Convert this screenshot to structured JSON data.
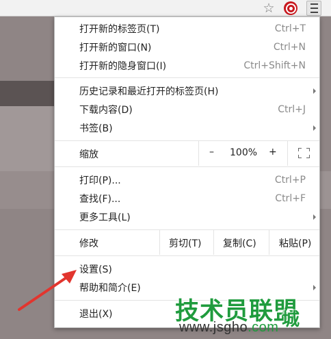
{
  "browser": {
    "star_glyph": "☆",
    "extension_icon": "red-circle-extension-icon",
    "menu_icon": "hamburger-icon"
  },
  "menu": {
    "group1": [
      {
        "label": "打开新的标签页(T)",
        "shortcut": "Ctrl+T"
      },
      {
        "label": "打开新的窗口(N)",
        "shortcut": "Ctrl+N"
      },
      {
        "label": "打开新的隐身窗口(I)",
        "shortcut": "Ctrl+Shift+N"
      }
    ],
    "group2": [
      {
        "label": "历史记录和最近打开的标签页(H)",
        "shortcut": ""
      },
      {
        "label": "下载内容(D)",
        "shortcut": "Ctrl+J"
      },
      {
        "label": "书签(B)",
        "shortcut": ""
      }
    ],
    "zoom": {
      "label": "缩放",
      "minus": "–",
      "value": "100%",
      "plus": "+"
    },
    "group3": [
      {
        "label": "打印(P)...",
        "shortcut": "Ctrl+P"
      },
      {
        "label": "查找(F)...",
        "shortcut": "Ctrl+F"
      },
      {
        "label": "更多工具(L)",
        "shortcut": ""
      }
    ],
    "edit": {
      "label": "修改",
      "cut": "剪切(T)",
      "copy": "复制(C)",
      "paste": "粘贴(P)"
    },
    "group4": [
      {
        "label": "设置(S)"
      },
      {
        "label": "帮助和简介(E)"
      }
    ],
    "exit": {
      "label": "退出(X)"
    }
  },
  "watermark": {
    "title": "技术员联盟",
    "city": "城",
    "url_main": "www.jsgho",
    "url_tld": ".com"
  },
  "colors": {
    "annotation_arrow": "#e2352e",
    "watermark_green": "#1f9b3d"
  }
}
